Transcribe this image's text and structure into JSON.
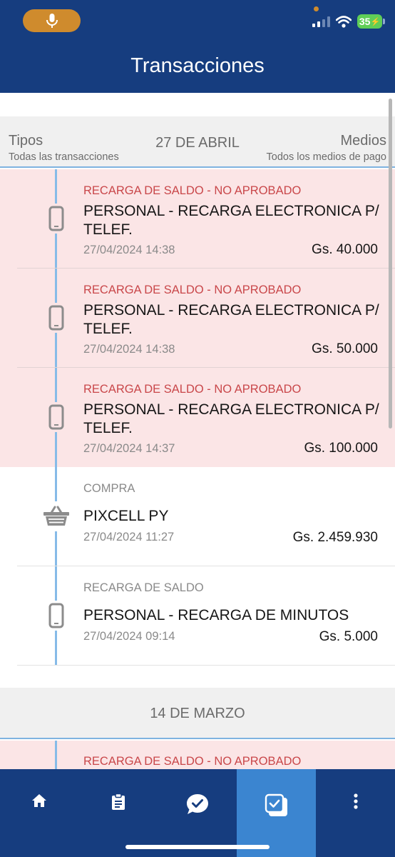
{
  "header": {
    "title": "Transacciones"
  },
  "status_bar": {
    "battery": "35"
  },
  "filters": {
    "types_label": "Tipos",
    "types_value": "Todas las transacciones",
    "date": "27 DE ABRIL",
    "media_label": "Medios",
    "media_value": "Todos los medios de pago"
  },
  "transactions": [
    {
      "category": "RECARGA DE SALDO - NO APROBADO",
      "description": "PERSONAL - RECARGA ELECTRONICA P/ TELEF.",
      "datetime": "27/04/2024 14:38",
      "amount": "Gs. 40.000",
      "icon": "phone-icon",
      "status": "no-aprobado"
    },
    {
      "category": "RECARGA DE SALDO - NO APROBADO",
      "description": "PERSONAL - RECARGA ELECTRONICA P/ TELEF.",
      "datetime": "27/04/2024 14:38",
      "amount": "Gs. 50.000",
      "icon": "phone-icon",
      "status": "no-aprobado"
    },
    {
      "category": "RECARGA DE SALDO - NO APROBADO",
      "description": "PERSONAL - RECARGA ELECTRONICA P/ TELEF.",
      "datetime": "27/04/2024 14:37",
      "amount": "Gs. 100.000",
      "icon": "phone-icon",
      "status": "no-aprobado"
    },
    {
      "category": "COMPRA",
      "description": "PIXCELL PY",
      "datetime": "27/04/2024 11:27",
      "amount": "Gs. 2.459.930",
      "icon": "shopping-basket-icon",
      "status": "ok"
    },
    {
      "category": "RECARGA DE SALDO",
      "description": "PERSONAL - RECARGA DE MINUTOS",
      "datetime": "27/04/2024 09:14",
      "amount": "Gs. 5.000",
      "icon": "phone-icon",
      "status": "ok"
    }
  ],
  "section2": {
    "date": "14 DE MARZO",
    "first_category": "RECARGA DE SALDO - NO APROBADO"
  },
  "nav": {
    "items": [
      "home-icon",
      "clipboard-icon",
      "chat-check-icon",
      "document-check-icon",
      "more-vertical-icon"
    ],
    "active_index": 3
  },
  "colors": {
    "header_bg": "#163d7f",
    "active_nav": "#3b85d0",
    "failed_bg": "#fbe5e6",
    "failed_text": "#c9474a",
    "timeline": "#86bbe8"
  }
}
